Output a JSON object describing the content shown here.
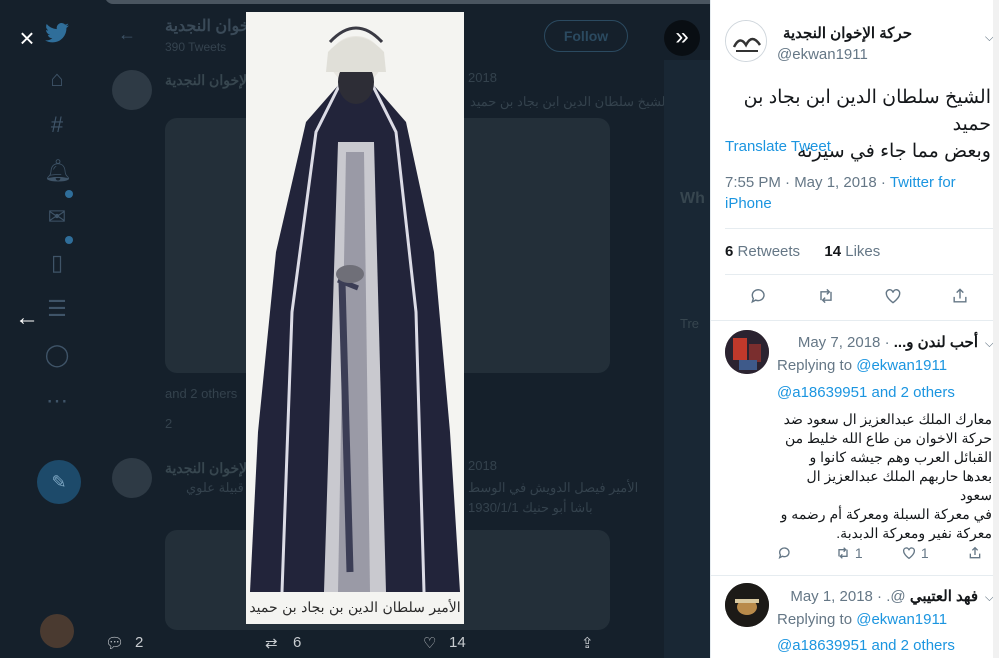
{
  "background": {
    "account_name": "حركة الإخوان النجدية",
    "tweet_count": "390 Tweets",
    "follow_label": "Follow",
    "tweet1_author": "حركة الإخوان النجدية",
    "tweet1_date": "2018",
    "tweet1_text": "الشيخ سلطان الدين ابن بجاد بن حميد",
    "tweet1_extra": "and 2 others",
    "tweet1_replies": "2",
    "tweet2_author": "حركة الإخوان النجدية",
    "tweet2_date": "2018",
    "tweet2_line1": "الأمير فيصل الدويش في الوسط",
    "tweet2_line2": "باشا أبو حنيك 1930/1/1",
    "tweet2_line3": "قبيلة علوي",
    "right_heading": "Wh",
    "right_trend": "Tre",
    "bottom_counts": {
      "replies": "2",
      "retweets": "6",
      "likes": "14"
    }
  },
  "photo": {
    "caption": "الأمير سلطان الدين بن بجاد بن حميد"
  },
  "overlay": {
    "close_label": "×",
    "prev_label": "←",
    "expand_label": "»"
  },
  "panel": {
    "author_name": "حركة الإخوان النجدية",
    "author_handle": "@ekwan1911",
    "tweet_text_line1": "الشيخ سلطان الدين ابن بجاد بن حميد",
    "tweet_text_line2": "وبعض مما جاء في سيرته",
    "translate_label": "Translate Tweet",
    "time": "7:55 PM · May 1, 2018 · ",
    "source": "Twitter for iPhone",
    "retweets_count": "6",
    "retweets_label": "Retweets",
    "likes_count": "14",
    "likes_label": "Likes",
    "replies": [
      {
        "name": "أحب لندن و...",
        "date": "· May 7, 2018",
        "replying_prefix": "Replying to ",
        "replying_to": "@ekwan1911",
        "replying_line2": "@a18639951 and 2 others",
        "body_lines": [
          "معارك الملك عبدالعزيز ال سعود ضد",
          "حركة الاخوان من طاع الله خليط من",
          "القبائل العرب  وهم جيشه كانوا و",
          "بعدها حاربهم  الملك عبدالعزيز ال سعود",
          "في  معركة السبلة ومعركة أم رضمه و",
          "معركة نفير ومعركة  الدبدبة."
        ],
        "retweets": "1",
        "likes": "1"
      },
      {
        "name": "فهد العتيبي",
        "handle": "@.",
        "date": "· May 1, 2018",
        "replying_prefix": "Replying to ",
        "replying_to": "@ekwan1911",
        "replying_line2": "@a18639951 and 2 others"
      }
    ]
  },
  "colors": {
    "link": "#1b95e0",
    "text_primary": "#14171a",
    "text_secondary": "#657786",
    "overlay_bg": "#15202b"
  }
}
